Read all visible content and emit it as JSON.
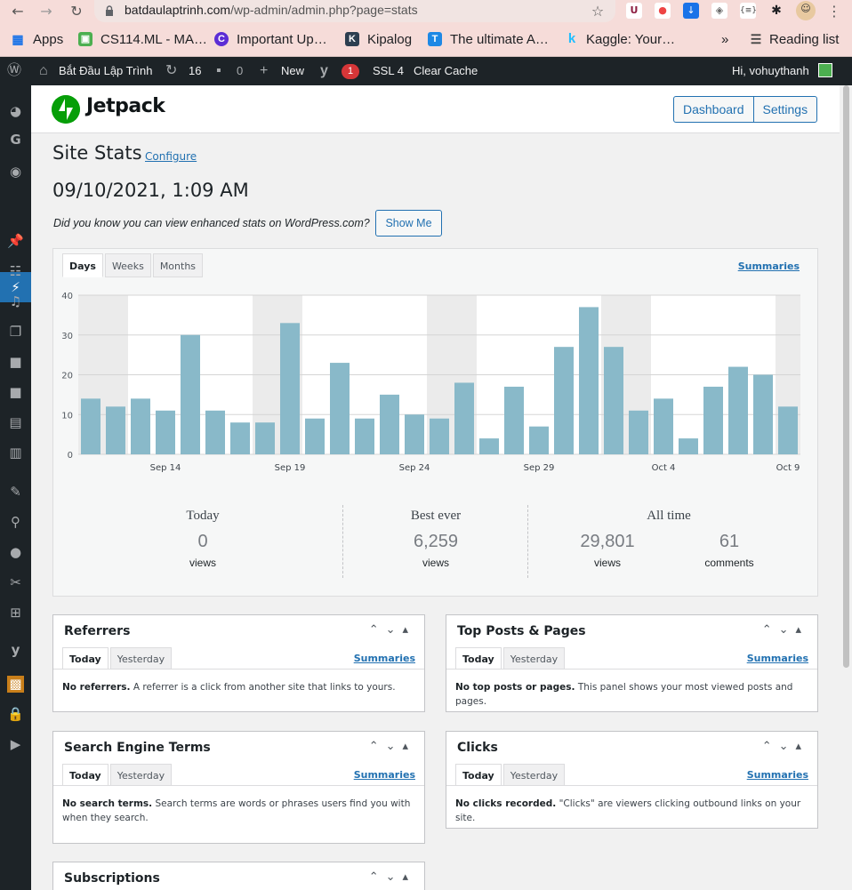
{
  "browser": {
    "url_domain": "batdaulaptrinh.com",
    "url_path": "/wp-admin/admin.php?page=stats",
    "bookmarks": [
      "Apps",
      "CS114.ML - MA…",
      "Important Up…",
      "Kipalog",
      "The ultimate A…",
      "Kaggle: Your…"
    ],
    "more": "»",
    "reading_list": "Reading list"
  },
  "adminbar": {
    "site_name": "Bắt Đầu Lập Trình",
    "updates_count": "16",
    "comments_count": "0",
    "new_label": "New",
    "yoast_badge": "1",
    "ssl_label": "SSL 4",
    "clear_cache_label": "Clear Cache",
    "greeting": "Hi, vohuythanh"
  },
  "jetpack": {
    "brand": "Jetpack",
    "dashboard_label": "Dashboard",
    "settings_label": "Settings"
  },
  "page": {
    "title": "Site Stats",
    "configure_label": "Configure",
    "datetime": "09/10/2021, 1:09 AM",
    "did_you_know": "Did you know you can view enhanced stats on WordPress.com?",
    "show_me_label": "Show Me"
  },
  "stats": {
    "tabs": [
      "Days",
      "Weeks",
      "Months"
    ],
    "summaries_label": "Summaries",
    "today_label": "Today",
    "today_value": "0",
    "today_unit": "views",
    "best_label": "Best ever",
    "best_value": "6,259",
    "best_unit": "views",
    "alltime_label": "All time",
    "alltime_views": "29,801",
    "alltime_views_unit": "views",
    "alltime_comments": "61",
    "alltime_comments_unit": "comments"
  },
  "chart_data": {
    "type": "bar",
    "ylim": [
      0,
      40
    ],
    "yticks": [
      0,
      10,
      20,
      30,
      40
    ],
    "x": [
      "Sep 11",
      "Sep 12",
      "Sep 13",
      "Sep 14",
      "Sep 15",
      "Sep 16",
      "Sep 17",
      "Sep 18",
      "Sep 19",
      "Sep 20",
      "Sep 21",
      "Sep 22",
      "Sep 23",
      "Sep 24",
      "Sep 25",
      "Sep 26",
      "Sep 27",
      "Sep 28",
      "Sep 29",
      "Sep 30",
      "Oct 1",
      "Oct 2",
      "Oct 3",
      "Oct 4",
      "Oct 5",
      "Oct 6",
      "Oct 7",
      "Oct 8",
      "Oct 9"
    ],
    "values": [
      14,
      12,
      14,
      11,
      30,
      11,
      8,
      8,
      33,
      9,
      23,
      9,
      15,
      10,
      9,
      18,
      4,
      17,
      7,
      27,
      37,
      27,
      11,
      14,
      4,
      17,
      22,
      20,
      12
    ],
    "xtick_labels": [
      "Sep 14",
      "Sep 19",
      "Sep 24",
      "Sep 29",
      "Oct 4",
      "Oct 9"
    ],
    "weekend_shaded": true,
    "bar_color": "#89b9c9",
    "grid": true
  },
  "panels": [
    {
      "title": "Referrers",
      "tabs": [
        "Today",
        "Yesterday"
      ],
      "summaries": "Summaries",
      "msg_bold": "No referrers.",
      "msg": " A referrer is a click from another site that links to yours."
    },
    {
      "title": "Top Posts & Pages",
      "tabs": [
        "Today",
        "Yesterday"
      ],
      "summaries": "Summaries",
      "msg_bold": "No top posts or pages.",
      "msg": " This panel shows your most viewed posts and pages."
    },
    {
      "title": "Search Engine Terms",
      "tabs": [
        "Today",
        "Yesterday"
      ],
      "summaries": "Summaries",
      "msg_bold": "No search terms.",
      "msg": " Search terms are words or phrases users find you with when they search."
    },
    {
      "title": "Clicks",
      "tabs": [
        "Today",
        "Yesterday"
      ],
      "summaries": "Summaries",
      "msg_bold": "No clicks recorded.",
      "msg": " \"Clicks\" are viewers clicking outbound links on your site."
    },
    {
      "title": "Subscriptions"
    }
  ]
}
